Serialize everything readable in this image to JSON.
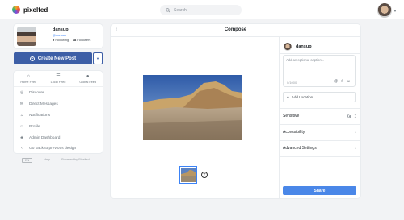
{
  "app": {
    "name": "pixelfed"
  },
  "search": {
    "placeholder": "Search"
  },
  "profile": {
    "display_name": "dansup",
    "handle": "@dansup",
    "following_count": "9",
    "following_label": "Following",
    "followers_count": "18",
    "followers_label": "Followers"
  },
  "create_post": {
    "label": "Create New Post"
  },
  "feeds": [
    {
      "label": "Home Feed",
      "icon": "home-icon"
    },
    {
      "label": "Local Feed",
      "icon": "list-icon"
    },
    {
      "label": "Global Feed",
      "icon": "globe-icon"
    }
  ],
  "menu": [
    {
      "label": "Discover",
      "icon": "compass-icon"
    },
    {
      "label": "Direct Messages",
      "icon": "message-icon"
    },
    {
      "label": "Notifications",
      "icon": "bell-icon"
    },
    {
      "label": "Profile",
      "icon": "user-icon"
    },
    {
      "label": "Admin Dashboard",
      "icon": "shield-icon"
    },
    {
      "label": "Go back to previous design",
      "icon": "chevron-left-icon"
    }
  ],
  "footer": {
    "language": "EN",
    "help": "Help",
    "powered": "Powered by Pixelfed"
  },
  "compose": {
    "title": "Compose",
    "username": "dansup",
    "caption_placeholder": "Add an optional caption...",
    "caption_count": "0/1000",
    "location_label": "Add Location",
    "sensitive_label": "Sensitive",
    "sensitive_on": false,
    "accessibility_label": "Accessibility",
    "advanced_label": "Advanced Settings",
    "share_label": "Share"
  },
  "colors": {
    "primary": "#3d5ea6",
    "share": "#4a87e8",
    "link": "#3b82f6"
  }
}
